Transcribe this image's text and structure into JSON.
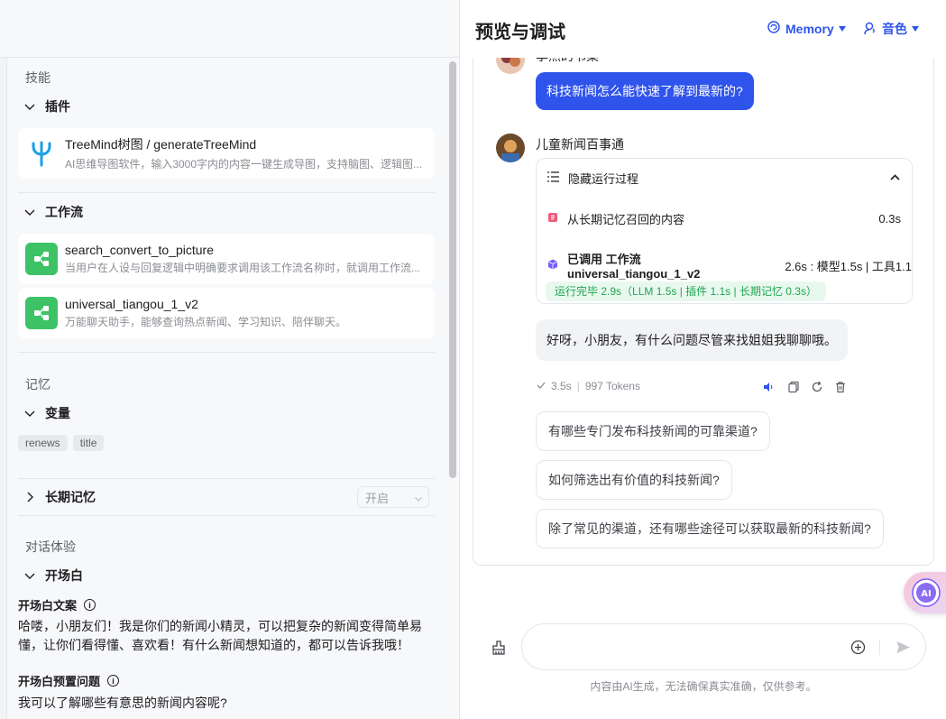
{
  "left": {
    "skills_title": "技能",
    "plugins": {
      "header": "插件",
      "items": [
        {
          "name": "TreeMind树图 / generateTreeMind",
          "desc": "AI思维导图软件，输入3000字内的内容一键生成导图，支持脑图、逻辑图..."
        }
      ]
    },
    "workflows": {
      "header": "工作流",
      "items": [
        {
          "name": "search_convert_to_picture",
          "desc": "当用户在人设与回复逻辑中明确要求调用该工作流名称时，就调用工作流..."
        },
        {
          "name": "universal_tiangou_1_v2",
          "desc": "万能聊天助手，能够查询热点新闻、学习知识、陪伴聊天。"
        }
      ]
    },
    "memory_title": "记忆",
    "variables": {
      "header": "变量",
      "tags": [
        "renews",
        "title"
      ]
    },
    "long_memory": {
      "header": "长期记忆",
      "select_value": "开启"
    },
    "experience_title": "对话体验",
    "opening": {
      "header": "开场白",
      "text_label": "开场白文案",
      "text": "哈喽，小朋友们！我是你们的新闻小精灵，可以把复杂的新闻变得简单易懂，让你们看得懂、喜欢看！有什么新闻想知道的，都可以告诉我哦！",
      "preset_label": "开场白预置问题",
      "preset_question": "我可以了解哪些有意思的新闻内容呢?"
    }
  },
  "right": {
    "title": "预览与调试",
    "memory_button": "Memory",
    "voice_button": "音色",
    "user_name_partial": "李然的书桌",
    "user_message": "科技新闻怎么能快速了解到最新的?",
    "bot_name": "儿童新闻百事通",
    "process": {
      "toggle_label": "隐藏运行过程",
      "rows": [
        {
          "label": "从长期记忆召回的内容",
          "value": "0.3s"
        },
        {
          "label_prefix": "已调用 工作流 universal_tiangou_1_v2",
          "value": "2.6s : 模型1.5s | 工具1.1"
        }
      ],
      "summary": "运行完毕 2.9s（LLM 1.5s | 插件 1.1s | 长期记忆 0.3s）"
    },
    "bot_reply": "好呀，小朋友，有什么问题尽管来找姐姐我聊聊哦。",
    "meta": {
      "time": "3.5s",
      "tokens": "997 Tokens"
    },
    "suggestions": [
      "有哪些专门发布科技新闻的可靠渠道?",
      "如何筛选出有价值的科技新闻?",
      "除了常见的渠道，还有哪些途径可以获取最新的科技新闻?"
    ],
    "input_placeholder": "",
    "disclaimer": "内容由AI生成，无法确保真实准确，仅供参考。"
  },
  "colors": {
    "accent": "#2f54eb",
    "workflow_icon": "#3ec266",
    "success": "#1fa651"
  }
}
